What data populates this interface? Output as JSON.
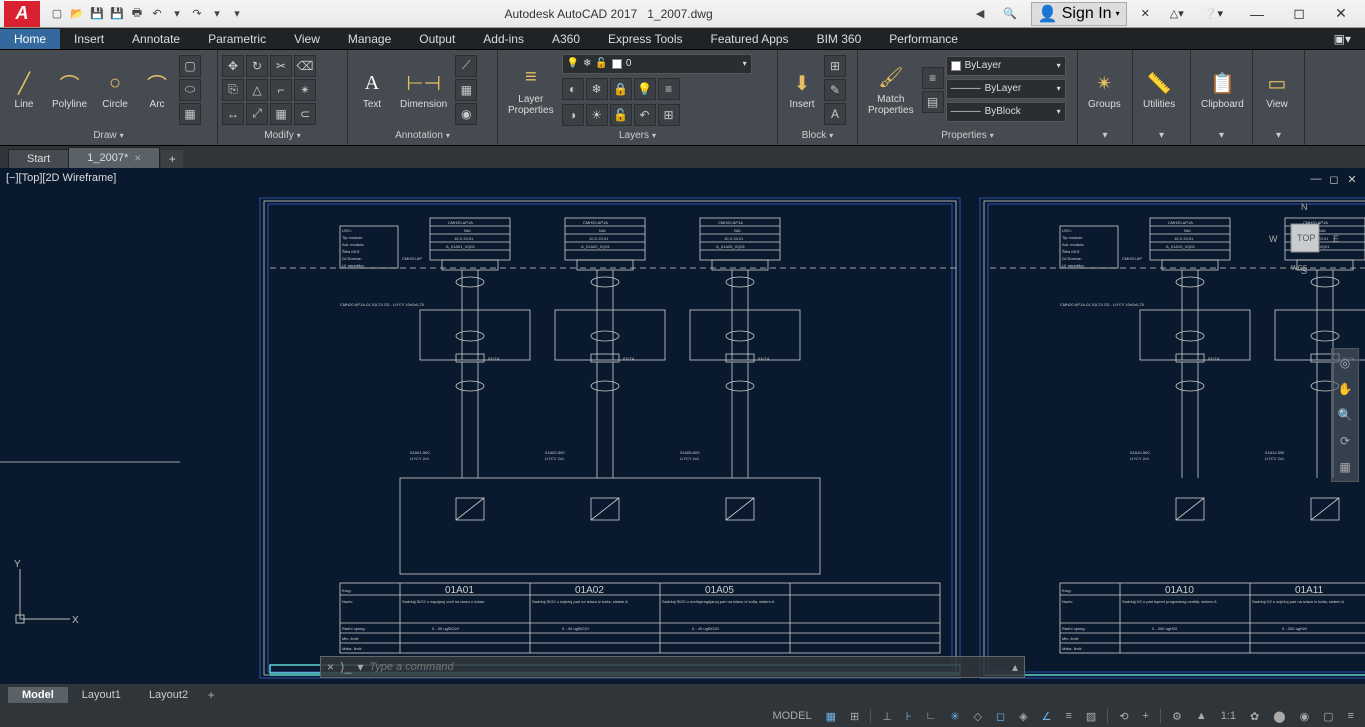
{
  "title": {
    "app": "Autodesk AutoCAD 2017",
    "file": "1_2007.dwg"
  },
  "signin": "Sign In",
  "ribbon_tabs": [
    "Home",
    "Insert",
    "Annotate",
    "Parametric",
    "View",
    "Manage",
    "Output",
    "Add-ins",
    "A360",
    "Express Tools",
    "Featured Apps",
    "BIM 360",
    "Performance"
  ],
  "panels": {
    "draw": {
      "label": "Draw",
      "line": "Line",
      "polyline": "Polyline",
      "circle": "Circle",
      "arc": "Arc"
    },
    "modify": {
      "label": "Modify"
    },
    "annotation": {
      "label": "Annotation",
      "text": "Text",
      "dimension": "Dimension"
    },
    "layers": {
      "label": "Layers",
      "properties": "Layer\nProperties",
      "current": "0"
    },
    "block": {
      "label": "Block",
      "insert": "Insert"
    },
    "properties": {
      "label": "Properties",
      "match": "Match\nProperties",
      "bylayer": "ByLayer",
      "byblock": "ByBlock"
    },
    "groups": {
      "label": "Groups"
    },
    "utilities": {
      "label": "Utilities"
    },
    "clipboard": {
      "label": "Clipboard"
    },
    "view": {
      "label": "View"
    }
  },
  "file_tabs": {
    "start": "Start",
    "current": "1_2007*"
  },
  "viewport_label": "[−][Top][2D Wireframe]",
  "cmdline_placeholder": "Type a command",
  "layout_tabs": [
    "Model",
    "Layout1",
    "Layout2"
  ],
  "status": {
    "model": "MODEL",
    "scale": "1:1"
  },
  "drawing": {
    "blocks": [
      {
        "col": 1,
        "label1": "CMH20.AP1A",
        "label2": "NAI",
        "label3": "10.X.20.01",
        "label4": "A_01A01_XQ01",
        "ref": "01A01-500",
        "cable": "LIYCY 2x1",
        "lt": "01LT4"
      },
      {
        "col": 2,
        "label1": "CMH20.AP1A",
        "label2": "NAI",
        "label3": "10.X.20.01",
        "label4": "A_01A02_XQ01",
        "ref": "01A02-500",
        "cable": "LIYCY 2x1",
        "lt": "01LT4"
      },
      {
        "col": 3,
        "label1": "CMH20.AP1A",
        "label2": "NAI",
        "label3": "10.X.20.01",
        "label4": "A_01A05_XQ01",
        "ref": "01A05-500",
        "cable": "LIYCY 2x1",
        "lt": "01LT4"
      },
      {
        "col": 4,
        "label1": "CMH20.AP1A",
        "label2": "NAI",
        "label3": "10.X.20.01",
        "label4": "A_01A10_XQ01",
        "ref": "01A10-500",
        "cable": "LIYCY 2x1",
        "lt": "01LT4"
      },
      {
        "col": 5,
        "label1": "CMH20.AP1A",
        "label2": "NAI",
        "label3": "10.X.20.01",
        "label4": "A_01A11_XQ01",
        "ref": "01A11-500",
        "cable": "LIYCY 2x1",
        "lt": "01LT4"
      }
    ],
    "left_labels": {
      "uso": "USO:",
      "tip": "Tip modula:",
      "adr": "Adr. modula:",
      "sifra": "Šifra KKS:",
      "dcs": "DCSormar:",
      "ul": "Ul. stezaljke:",
      "cmh": "CMH20.AP"
    },
    "cable_block": "CMH20.AP1A-01.01LT4\nSD - LiYCY 10x2x0,75",
    "bottom": {
      "krug": "Krug:",
      "naziv": "Naziv:",
      "radni": "Radni opseg:",
      "min": "Min. limit:",
      "maks": "Maks. limit:",
      "k1": "01A01",
      "k2": "01A02",
      "k3": "01A05",
      "k4": "01A10",
      "k5": "01A11",
      "n1": "Sadržaj SiO2 u napojnoj vodi na ulazu u kotao",
      "n2": "Sadržaj SiO2 u svježoj pari na izlazu iz kotla, sistem A",
      "n3": "Sadržaj SiO2 u međupregrijanoj pari na izlazu iz kotla, sistem A",
      "n4": "Sadržaj H2 u pari ispred pregradnog ventila, sistem A",
      "n5": "Sadržaj H2 u svježoj pari na izlazu iz kotla, sistem A",
      "r1": "0 - 40  ugSiO2/l",
      "r2": "0 - 40  ugSiO2/l",
      "r3": "0 - 40  ugSiO2/l",
      "r4": "0 - 200  ugH2/l",
      "r5": "0 - 200  ugH2/l"
    }
  },
  "navcube": {
    "top": "TOP",
    "n": "N",
    "s": "S",
    "e": "E",
    "w": "W",
    "wcs": "WCS"
  }
}
